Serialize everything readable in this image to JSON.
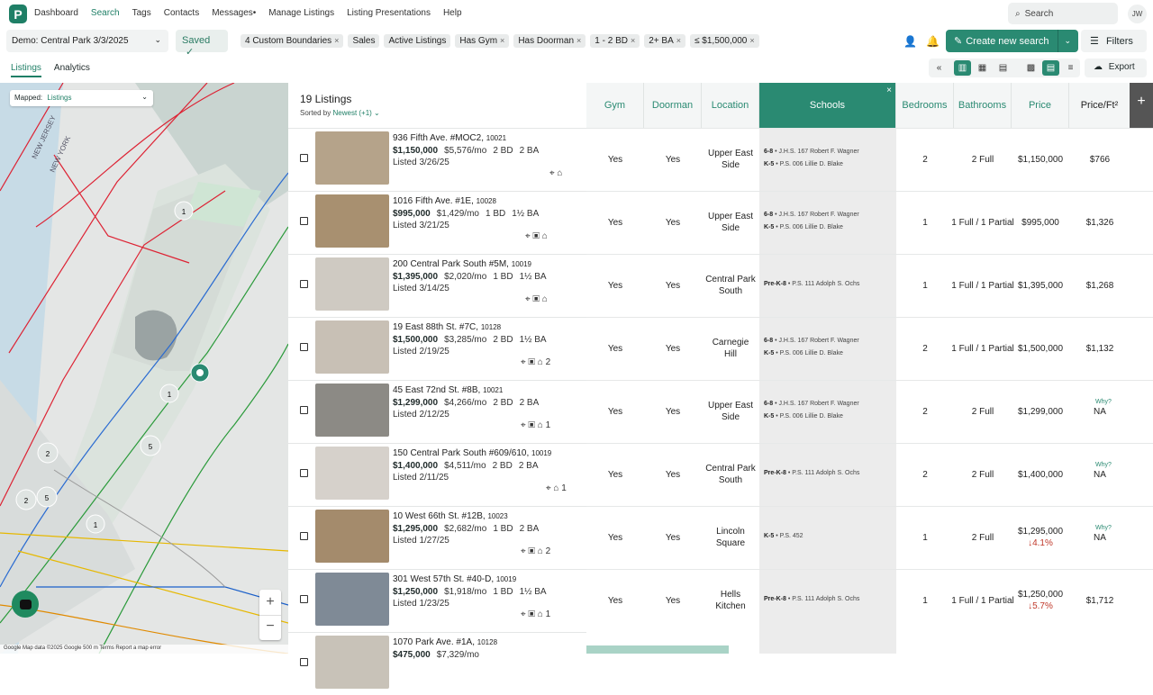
{
  "nav": {
    "logo": "P",
    "items": [
      "Dashboard",
      "Search",
      "Tags",
      "Contacts",
      "Messages•",
      "Manage Listings",
      "Listing Presentations",
      "Help"
    ],
    "search": "Search",
    "avatar": "JW"
  },
  "toolbar": {
    "search_name": "Demo: Central Park 3/3/2025",
    "saved": "Saved",
    "chips": [
      "4 Custom Boundaries",
      "Sales",
      "Active Listings",
      "Has Gym",
      "Has Doorman",
      "1 - 2 BD",
      "2+ BA",
      "≤ $1,500,000"
    ],
    "create": "Create new search",
    "filters": "Filters",
    "export": "Export"
  },
  "tabs": [
    "Listings",
    "Analytics"
  ],
  "map": {
    "mapped_label": "Mapped:",
    "mapped_value": "Listings",
    "footer": "Google   Map data ©2025 Google   500 m   Terms   Report a map error",
    "labels": [
      "NEW JERSEY",
      "NEW YORK"
    ],
    "clusters": [
      "1",
      "1",
      "2",
      "5",
      "2",
      "5",
      "1"
    ]
  },
  "list": {
    "count": "19 Listings",
    "sorted_label": "Sorted by",
    "sorted_value": "Newest (+1) ⌄"
  },
  "columns": [
    "Gym",
    "Doorman",
    "Location",
    "Schools",
    "Bedrooms",
    "Bathrooms",
    "Price",
    "Price/Ft²"
  ],
  "listings": [
    {
      "addr": "936 Fifth Ave. #MOC2,",
      "zip": "10021",
      "price": "$1,150,000",
      "mo": "$5,576/mo",
      "bd": "2 BD",
      "ba": "2 BA",
      "listed": "Listed 3/26/25",
      "icons": "⌖   ⌂",
      "gym": "Yes",
      "doorman": "Yes",
      "location": "Upper East Side",
      "s1g": "6-8",
      "s1": "J.H.S. 167 Robert F. Wagner",
      "s2g": "K-5",
      "s2": "P.S. 006 Lillie D. Blake",
      "beds": "2",
      "baths": "2 Full",
      "tprice": "$1,150,000",
      "ppf": "$766",
      "chg": "",
      "why": ""
    },
    {
      "addr": "1016 Fifth Ave. #1E,",
      "zip": "10028",
      "price": "$995,000",
      "mo": "$1,429/mo",
      "bd": "1 BD",
      "ba": "1½ BA",
      "listed": "Listed 3/21/25",
      "icons": "⌖   ▣   ⌂",
      "gym": "Yes",
      "doorman": "Yes",
      "location": "Upper East Side",
      "s1g": "6-8",
      "s1": "J.H.S. 167 Robert F. Wagner",
      "s2g": "K-5",
      "s2": "P.S. 006 Lillie D. Blake",
      "beds": "1",
      "baths": "1 Full / 1 Partial",
      "tprice": "$995,000",
      "ppf": "$1,326",
      "chg": "",
      "why": ""
    },
    {
      "addr": "200 Central Park South #5M,",
      "zip": "10019",
      "price": "$1,395,000",
      "mo": "$2,020/mo",
      "bd": "1 BD",
      "ba": "1½ BA",
      "listed": "Listed 3/14/25",
      "icons": "⌖   ▣   ⌂",
      "gym": "Yes",
      "doorman": "Yes",
      "location": "Central Park South",
      "s1g": "Pre-K-8",
      "s1": "P.S. 111 Adolph S. Ochs",
      "s2g": "",
      "s2": "",
      "beds": "1",
      "baths": "1 Full / 1 Partial",
      "tprice": "$1,395,000",
      "ppf": "$1,268",
      "chg": "",
      "why": ""
    },
    {
      "addr": "19 East 88th St. #7C,",
      "zip": "10128",
      "price": "$1,500,000",
      "mo": "$3,285/mo",
      "bd": "2 BD",
      "ba": "1½ BA",
      "listed": "Listed 2/19/25",
      "icons": "⌖   ▣   ⌂ 2",
      "gym": "Yes",
      "doorman": "Yes",
      "location": "Carnegie Hill",
      "s1g": "6-8",
      "s1": "J.H.S. 167 Robert F. Wagner",
      "s2g": "K-5",
      "s2": "P.S. 006 Lillie D. Blake",
      "beds": "2",
      "baths": "1 Full / 1 Partial",
      "tprice": "$1,500,000",
      "ppf": "$1,132",
      "chg": "",
      "why": ""
    },
    {
      "addr": "45 East 72nd St. #8B,",
      "zip": "10021",
      "price": "$1,299,000",
      "mo": "$4,266/mo",
      "bd": "2 BD",
      "ba": "2 BA",
      "listed": "Listed 2/12/25",
      "icons": "⌖   ▣   ⌂ 1",
      "gym": "Yes",
      "doorman": "Yes",
      "location": "Upper East Side",
      "s1g": "6-8",
      "s1": "J.H.S. 167 Robert F. Wagner",
      "s2g": "K-5",
      "s2": "P.S. 006 Lillie D. Blake",
      "beds": "2",
      "baths": "2 Full",
      "tprice": "$1,299,000",
      "ppf": "NA",
      "chg": "",
      "why": "Why?"
    },
    {
      "addr": "150 Central Park South #609/610,",
      "zip": "10019",
      "price": "$1,400,000",
      "mo": "$4,511/mo",
      "bd": "2 BD",
      "ba": "2 BA",
      "listed": "Listed 2/11/25",
      "icons": "⌖   ⌂ 1",
      "gym": "Yes",
      "doorman": "Yes",
      "location": "Central Park South",
      "s1g": "Pre-K-8",
      "s1": "P.S. 111 Adolph S. Ochs",
      "s2g": "",
      "s2": "",
      "beds": "2",
      "baths": "2 Full",
      "tprice": "$1,400,000",
      "ppf": "NA",
      "chg": "",
      "why": "Why?"
    },
    {
      "addr": "10 West 66th St. #12B,",
      "zip": "10023",
      "price": "$1,295,000",
      "mo": "$2,682/mo",
      "bd": "1 BD",
      "ba": "2 BA",
      "listed": "Listed 1/27/25",
      "icons": "⌖   ▣   ⌂ 2",
      "gym": "Yes",
      "doorman": "Yes",
      "location": "Lincoln Square",
      "s1g": "K-5",
      "s1": "P.S. 452",
      "s2g": "",
      "s2": "",
      "beds": "1",
      "baths": "2 Full",
      "tprice": "$1,295,000",
      "ppf": "NA",
      "chg": "↓4.1%",
      "why": "Why?"
    },
    {
      "addr": "301 West 57th St. #40-D,",
      "zip": "10019",
      "price": "$1,250,000",
      "mo": "$1,918/mo",
      "bd": "1 BD",
      "ba": "1½ BA",
      "listed": "Listed 1/23/25",
      "icons": "⌖   ▣   ⌂ 1",
      "gym": "Yes",
      "doorman": "Yes",
      "location": "Hells Kitchen",
      "s1g": "Pre-K-8",
      "s1": "P.S. 111 Adolph S. Ochs",
      "s2g": "",
      "s2": "",
      "beds": "1",
      "baths": "1 Full / 1 Partial",
      "tprice": "$1,250,000",
      "ppf": "$1,712",
      "chg": "↓5.7%",
      "why": ""
    },
    {
      "addr": "1070 Park Ave. #1A,",
      "zip": "10128",
      "price": "$475,000",
      "mo": "$7,329/mo",
      "bd": "",
      "ba": "",
      "listed": "",
      "icons": "",
      "gym": "",
      "doorman": "",
      "location": "",
      "s1g": "",
      "s1": "",
      "s2g": "",
      "s2": "",
      "beds": "",
      "baths": "",
      "tprice": "",
      "ppf": "",
      "chg": "",
      "why": ""
    }
  ]
}
